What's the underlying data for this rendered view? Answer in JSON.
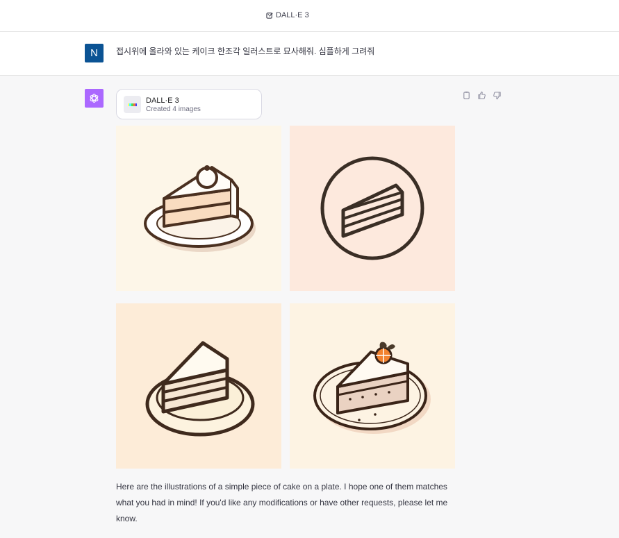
{
  "header": {
    "title": "DALL·E 3",
    "icon": "gpt-edit-icon"
  },
  "user_message": {
    "avatar_letter": "N",
    "avatar_color": "#0b5394",
    "text": "접시위에 올라와 있는 케이크 한조각 일러스트로 묘사해줘. 심플하게 그려줘"
  },
  "assistant": {
    "avatar_color": "#ab68ff",
    "avatar_icon": "openai-logo-icon",
    "tool_card": {
      "name": "DALL·E 3",
      "status": "Created 4 images"
    },
    "actions": [
      "copy-icon",
      "thumbs-up-icon",
      "thumbs-down-icon"
    ],
    "images": [
      {
        "name": "cake-image-1"
      },
      {
        "name": "cake-image-2"
      },
      {
        "name": "cake-image-3"
      },
      {
        "name": "cake-image-4"
      }
    ],
    "reply": "Here are the illustrations of a simple piece of cake on a plate. I hope one of them matches what you had in mind! If you'd like any modifications or have other requests, please let me know."
  },
  "colors": {
    "outline": "#4a3020",
    "user_avatar": "#0b5394",
    "bot_avatar": "#ab68ff"
  }
}
